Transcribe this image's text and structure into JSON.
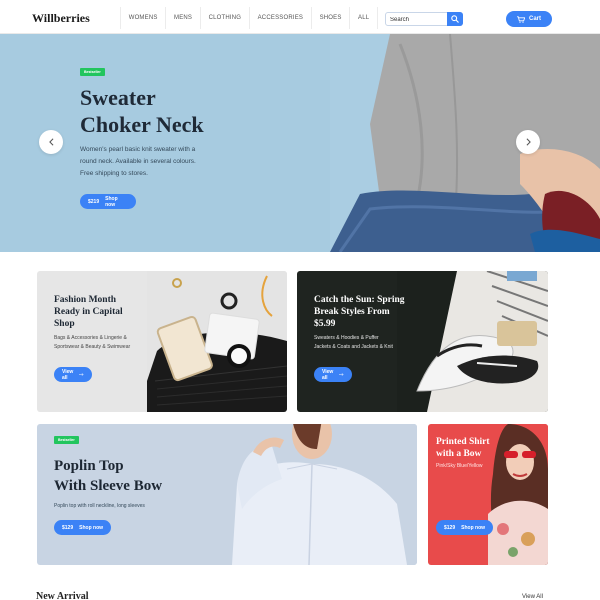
{
  "header": {
    "logo": "Willberries",
    "nav": [
      "WOMENS",
      "MENS",
      "CLOTHING",
      "ACCESSORIES",
      "SHOES",
      "ALL"
    ],
    "search_placeholder": "Search",
    "search_icon": "search-icon",
    "cart_label": "Cart",
    "cart_icon": "cart-icon"
  },
  "hero": {
    "badge": "Bestseller",
    "title_line1": "Sweater",
    "title_line2": "Choker Neck",
    "description": "Women's pearl basic knit sweater with a round neck. Available in several colours. Free shipping to stores.",
    "price": "$219",
    "cta": "Shop now",
    "prev_icon": "chevron-left-icon",
    "next_icon": "chevron-right-icon",
    "background": "#a7cbe0"
  },
  "cards": [
    {
      "title": "Fashion Month Ready in Capital Shop",
      "description": "Bags & Accessories & Lingerie & Sportswear & Beauty & Swimwear",
      "cta": "View all",
      "cta_icon": "arrow-right-icon"
    },
    {
      "title": "Catch the Sun: Spring Break Styles From $5.99",
      "description": "Sweaters & Hoodies & Puffer Jackets & Coats and Jackets & Knit",
      "cta": "View all",
      "cta_icon": "arrow-right-icon"
    },
    {
      "badge": "Bestseller",
      "title_line1": "Poplin Top",
      "title_line2": "With Sleeve Bow",
      "description": "Poplin top with roll neckline, long sleeves",
      "price": "$129",
      "cta": "Shop now"
    },
    {
      "title": "Printed Shirt with a Bow",
      "description": "Pink/Sky Blue/Yellow",
      "price": "$129",
      "cta": "Shop now"
    }
  ],
  "new_arrival": {
    "title": "New Arrival",
    "view_all": "View All"
  },
  "colors": {
    "accent": "#3b82f6",
    "badge": "#22c55e",
    "card4": "#e84b4b"
  }
}
